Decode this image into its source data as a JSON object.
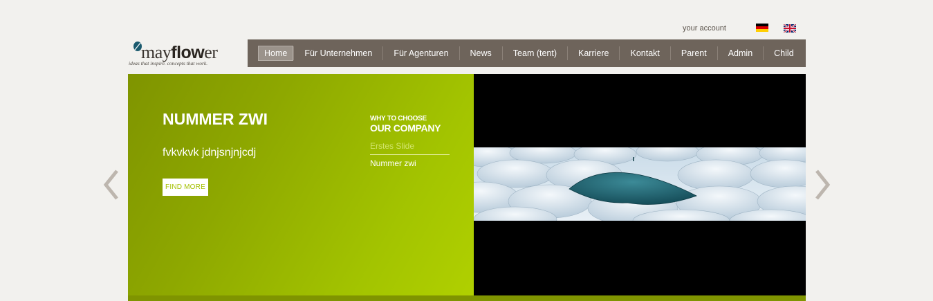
{
  "header": {
    "account_link": "your account",
    "languages": [
      {
        "code": "de",
        "icon": "german-flag-icon"
      },
      {
        "code": "en",
        "icon": "uk-flag-icon"
      }
    ]
  },
  "logo": {
    "name_light": "may",
    "name_bold": "flow",
    "name_end": "er",
    "tagline": "ideas that inspire. concepts that work."
  },
  "nav": {
    "items": [
      {
        "label": "Home",
        "active": true
      },
      {
        "label": "Für Unternehmen"
      },
      {
        "label": "Für Agenturen"
      },
      {
        "label": "News"
      },
      {
        "label": "Team (tent)"
      },
      {
        "label": "Karriere"
      },
      {
        "label": "Kontakt"
      },
      {
        "label": "Parent"
      },
      {
        "label": "Admin"
      },
      {
        "label": "Child"
      }
    ]
  },
  "slider": {
    "title": "NUMMER ZWI",
    "subtitle": "fvkvkvk jdnjsnjnjcdj",
    "cta_label": "FIND MORE",
    "choose_small": "WHY TO CHOOSE",
    "choose_big": "OUR COMPANY",
    "slides": [
      "Erstes Slide",
      "Nummer zwi"
    ],
    "image_icon": "umbrellas-image",
    "prev_icon": "chevron-left-icon",
    "next_icon": "chevron-right-icon"
  },
  "colors": {
    "nav_bg": "#6e645b",
    "slide_green": "#8ea800",
    "accent_lime": "#a4c000",
    "page_bg": "#f2f1ee"
  }
}
